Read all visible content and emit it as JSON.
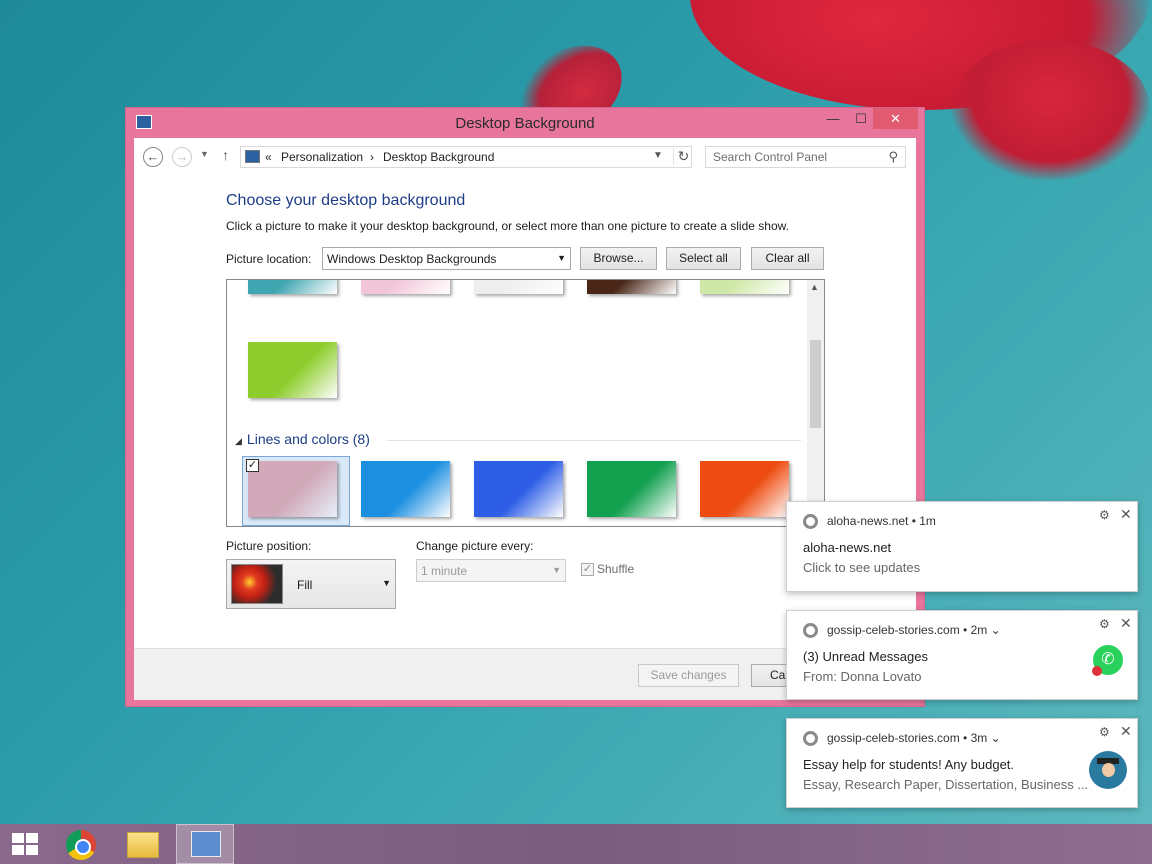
{
  "window": {
    "title": "Desktop Background",
    "controls": {
      "minimize": "—",
      "maximize": "☐",
      "close": "✕"
    }
  },
  "nav": {
    "back": "←",
    "forward": "→",
    "dropdown": "▼",
    "up": "↑",
    "breadcrumb": {
      "prefix": "«",
      "items": [
        "Personalization",
        "Desktop Background"
      ],
      "separator": "›"
    },
    "refresh": "↻",
    "search_placeholder": "Search Control Panel"
  },
  "content": {
    "heading": "Choose your desktop background",
    "subtext": "Click a picture to make it your desktop background, or select more than one picture to create a slide show.",
    "location_label": "Picture location:",
    "location_value": "Windows Desktop Backgrounds",
    "browse_label": "Browse...",
    "select_all_label": "Select all",
    "clear_all_label": "Clear all"
  },
  "gallery": {
    "group_title": "Lines and colors (8)",
    "scroll_up": "▲",
    "selected_check": "✓",
    "top_row_colors": [
      "#3fa5b1",
      "#f2c6d9",
      "#eeeeee",
      "#4a2718",
      "#cfe8a8"
    ],
    "nature_thumb_color": "#8fcd2e",
    "lines_thumb_colors": [
      "#d1a9b8",
      "#1d8fe0",
      "#2f5ee6",
      "#13a150",
      "#ee4b12"
    ]
  },
  "settings": {
    "position_label": "Picture position:",
    "position_value": "Fill",
    "change_label": "Change picture every:",
    "change_value": "1 minute",
    "shuffle_label": "Shuffle",
    "shuffle_check": "✓"
  },
  "footer": {
    "save_label": "Save changes",
    "cancel_label": "Car"
  },
  "notifications": [
    {
      "header": "aloha-news.net  •  1m",
      "title": "aloha-news.net",
      "body": "Click to see updates"
    },
    {
      "header": "gossip-celeb-stories.com  •  2m ⌄",
      "title": "(3) Unread Messages",
      "body": "From: Donna Lovato"
    },
    {
      "header": "gossip-celeb-stories.com  •  3m ⌄",
      "title": "Essay help for students! Any budget.",
      "body": "Essay, Research Paper, Dissertation, Business ..."
    }
  ],
  "notification_icons": {
    "gear": "⚙",
    "close": "✕",
    "whatsapp": "✆"
  },
  "taskbar": {
    "items": [
      "start",
      "chrome",
      "file-explorer",
      "control-panel"
    ]
  },
  "colors": {
    "window_frame": "#e8759b",
    "heading": "#1e3d87",
    "taskbar": "#7f6381"
  }
}
